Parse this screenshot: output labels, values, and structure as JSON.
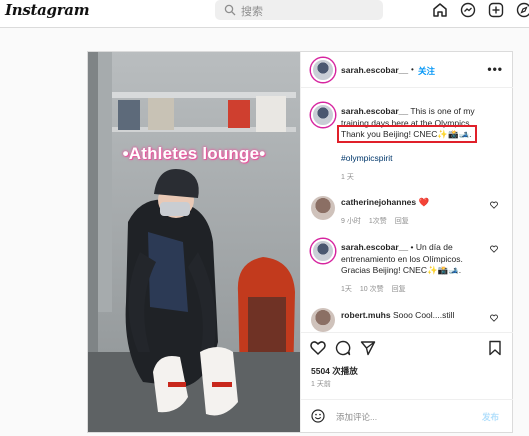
{
  "app": {
    "logo": "Instagram"
  },
  "search": {
    "placeholder": "搜索"
  },
  "post": {
    "author": "sarah.escobar__",
    "separator": "•",
    "follow_label": "关注",
    "more_label": "•••",
    "image_overlay_text": "•Athletes lounge•",
    "caption": {
      "username": "sarah.escobar__",
      "line1": "This is one of my",
      "line2": "training days here at the Olympics.",
      "line3": "Thank you Beijing! CNEC✨📸🎿.",
      "hashtag": "#olympicspirit",
      "time": "1 天"
    },
    "comments": [
      {
        "username": "catherinejohannes",
        "text": "❤️",
        "time": "9 小时",
        "likes": "1次赞",
        "reply": "回复"
      },
      {
        "username": "sarah.escobar__",
        "line1": "• Un día de",
        "line2": "entrenamiento en los Olímpicos.",
        "line3": "Gracias Beijing! CNEC✨📸🎿.",
        "time": "1天",
        "likes": "10 次赞",
        "reply": "回复"
      },
      {
        "username": "robert.muhs",
        "text": "Sooo Cool....still"
      }
    ],
    "likes_count": "5504 次播放",
    "date": "1 天前",
    "add_comment_placeholder": "添加评论...",
    "post_label": "发布"
  },
  "colors": {
    "accent_blue": "#0095f6",
    "highlight_red": "#e0202a",
    "heart_red": "#ed4956"
  }
}
